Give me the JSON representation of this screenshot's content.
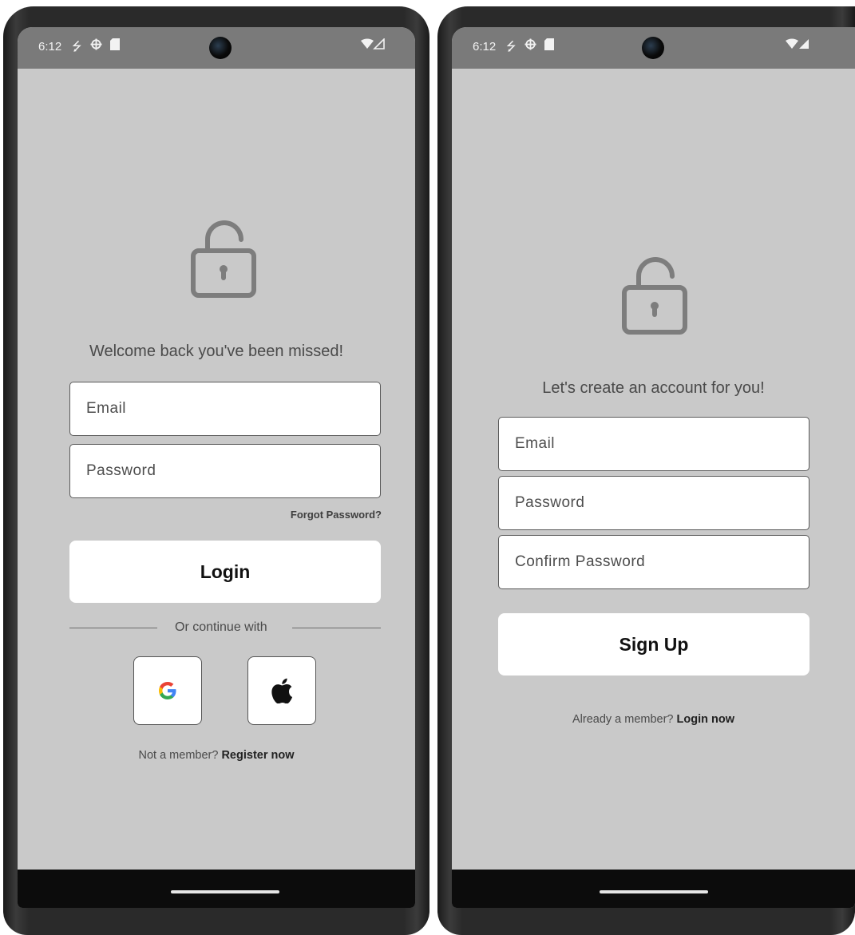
{
  "status_bar": {
    "time": "6:12",
    "icons": [
      "usb-debug-icon",
      "settings-gear-icon",
      "sd-card-icon"
    ],
    "network": "wifi-signal-icon"
  },
  "login_screen": {
    "welcome_text": "Welcome back you've been missed!",
    "email_placeholder": "Email",
    "password_placeholder": "Password",
    "forgot_password": "Forgot Password?",
    "login_button": "Login",
    "divider_text": "Or continue with",
    "social": [
      "google-icon",
      "apple-icon"
    ],
    "footer_prompt": "Not a member?",
    "footer_link": "Register now"
  },
  "signup_screen": {
    "title_text": "Let's create an account for you!",
    "email_placeholder": "Email",
    "password_placeholder": "Password",
    "confirm_password_placeholder": "Confirm Password",
    "signup_button": "Sign Up",
    "footer_prompt": "Already a member?",
    "footer_link": "Login now"
  },
  "colors": {
    "screen_bg": "#c9c9c9",
    "status_bar_bg": "#7a7a7a",
    "icon_gray": "#7d7d7d",
    "button_bg": "#ffffff"
  }
}
